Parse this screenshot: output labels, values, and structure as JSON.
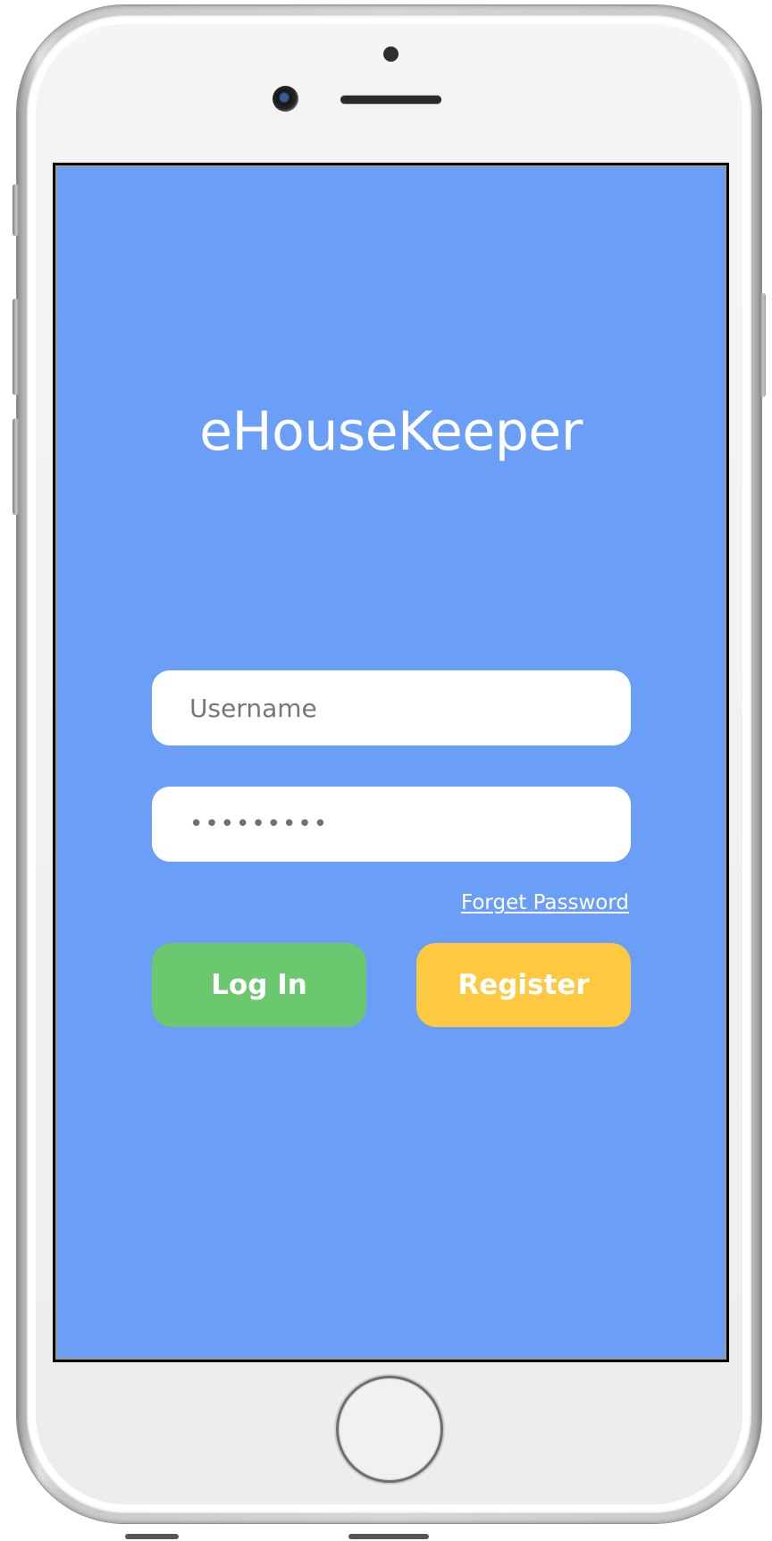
{
  "app": {
    "title": "eHouseKeeper"
  },
  "login_form": {
    "username_placeholder": "Username",
    "password_value": "•••••••••",
    "forgot_password_label": "Forget Password",
    "login_label": "Log In",
    "register_label": "Register"
  },
  "colors": {
    "screen_background": "#6a9ef7",
    "login_button": "#6cc86f",
    "register_button": "#fcc941",
    "text_on_color": "#ffffff"
  },
  "device": {
    "icons": {
      "front_camera": "camera-icon",
      "proximity_sensor": "sensor-icon",
      "earpiece": "speaker-icon",
      "home_button": "home-button-icon"
    }
  }
}
